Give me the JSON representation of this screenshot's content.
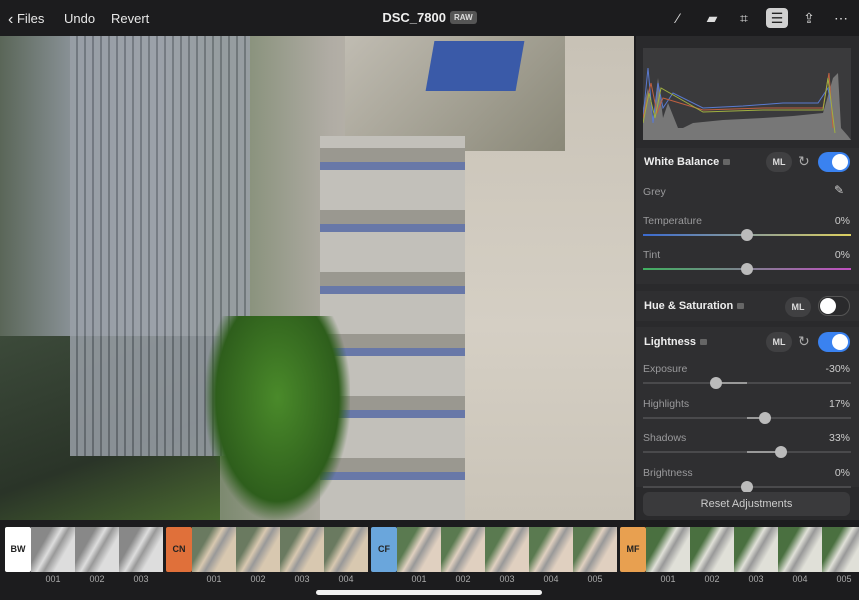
{
  "topbar": {
    "back_label": "Files",
    "undo_label": "Undo",
    "revert_label": "Revert",
    "title": "DSC_7800",
    "badge": "RAW",
    "icons": [
      "ml-magic-wand-icon",
      "bandage-icon",
      "crop-icon",
      "adjustments-sliders-icon",
      "share-icon",
      "more-icon"
    ],
    "active_icon": "adjustments-sliders-icon"
  },
  "panel": {
    "white_balance": {
      "title": "White Balance",
      "ml": "ML",
      "enabled": true,
      "grey_label": "Grey",
      "sliders": [
        {
          "label": "Temperature",
          "value": "0%",
          "percent": 0
        },
        {
          "label": "Tint",
          "value": "0%",
          "percent": 0
        }
      ]
    },
    "hue_saturation": {
      "title": "Hue & Saturation",
      "ml": "ML",
      "enabled": false
    },
    "lightness": {
      "title": "Lightness",
      "ml": "ML",
      "enabled": true,
      "sliders": [
        {
          "label": "Exposure",
          "value": "-30%",
          "percent": -30
        },
        {
          "label": "Highlights",
          "value": "17%",
          "percent": 17
        },
        {
          "label": "Shadows",
          "value": "33%",
          "percent": 33
        },
        {
          "label": "Brightness",
          "value": "0%",
          "percent": 0
        }
      ]
    },
    "reset_label": "Reset Adjustments"
  },
  "filmstrip": [
    {
      "tag": "BW",
      "color": "#ffffff",
      "items": [
        "001",
        "002",
        "003"
      ]
    },
    {
      "tag": "CN",
      "color": "#e0703a",
      "items": [
        "001",
        "002",
        "003",
        "004"
      ]
    },
    {
      "tag": "CF",
      "color": "#6aa6dc",
      "items": [
        "001",
        "002",
        "003",
        "004",
        "005"
      ]
    },
    {
      "tag": "MF",
      "color": "#e8a050",
      "items": [
        "001",
        "002",
        "003",
        "004",
        "005"
      ]
    }
  ]
}
